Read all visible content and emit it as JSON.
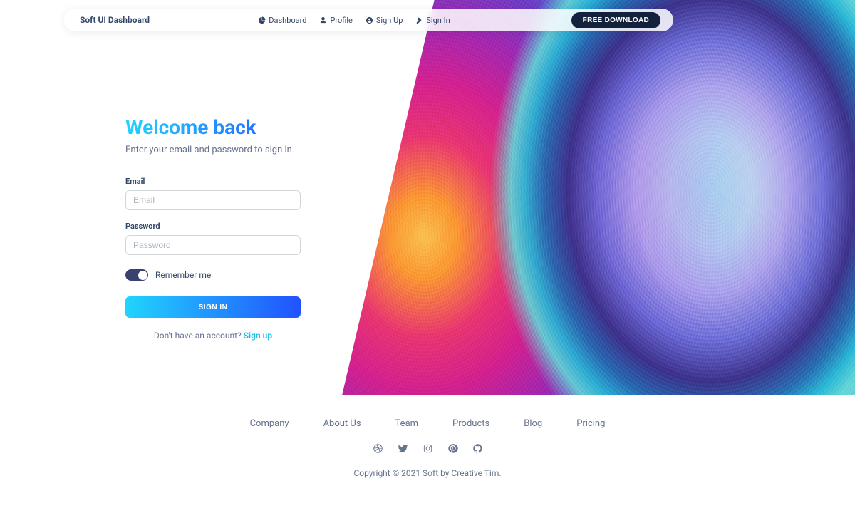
{
  "navbar": {
    "brand": "Soft UI Dashboard",
    "links": [
      {
        "label": "Dashboard"
      },
      {
        "label": "Profile"
      },
      {
        "label": "Sign Up"
      },
      {
        "label": "Sign In"
      }
    ],
    "download_label": "FREE DOWNLOAD"
  },
  "form": {
    "title": "Welcome back",
    "subtitle": "Enter your email and password to sign in",
    "email_label": "Email",
    "email_placeholder": "Email",
    "email_value": "",
    "password_label": "Password",
    "password_placeholder": "Password",
    "password_value": "",
    "remember_label": "Remember me",
    "remember_checked": true,
    "signin_label": "SIGN IN",
    "signup_prompt": "Don't have an account? ",
    "signup_link": "Sign up"
  },
  "footer": {
    "links": [
      "Company",
      "About Us",
      "Team",
      "Products",
      "Blog",
      "Pricing"
    ],
    "social": [
      "dribbble",
      "twitter",
      "instagram",
      "pinterest",
      "github"
    ],
    "copyright": "Copyright © 2021 Soft by Creative Tim."
  }
}
